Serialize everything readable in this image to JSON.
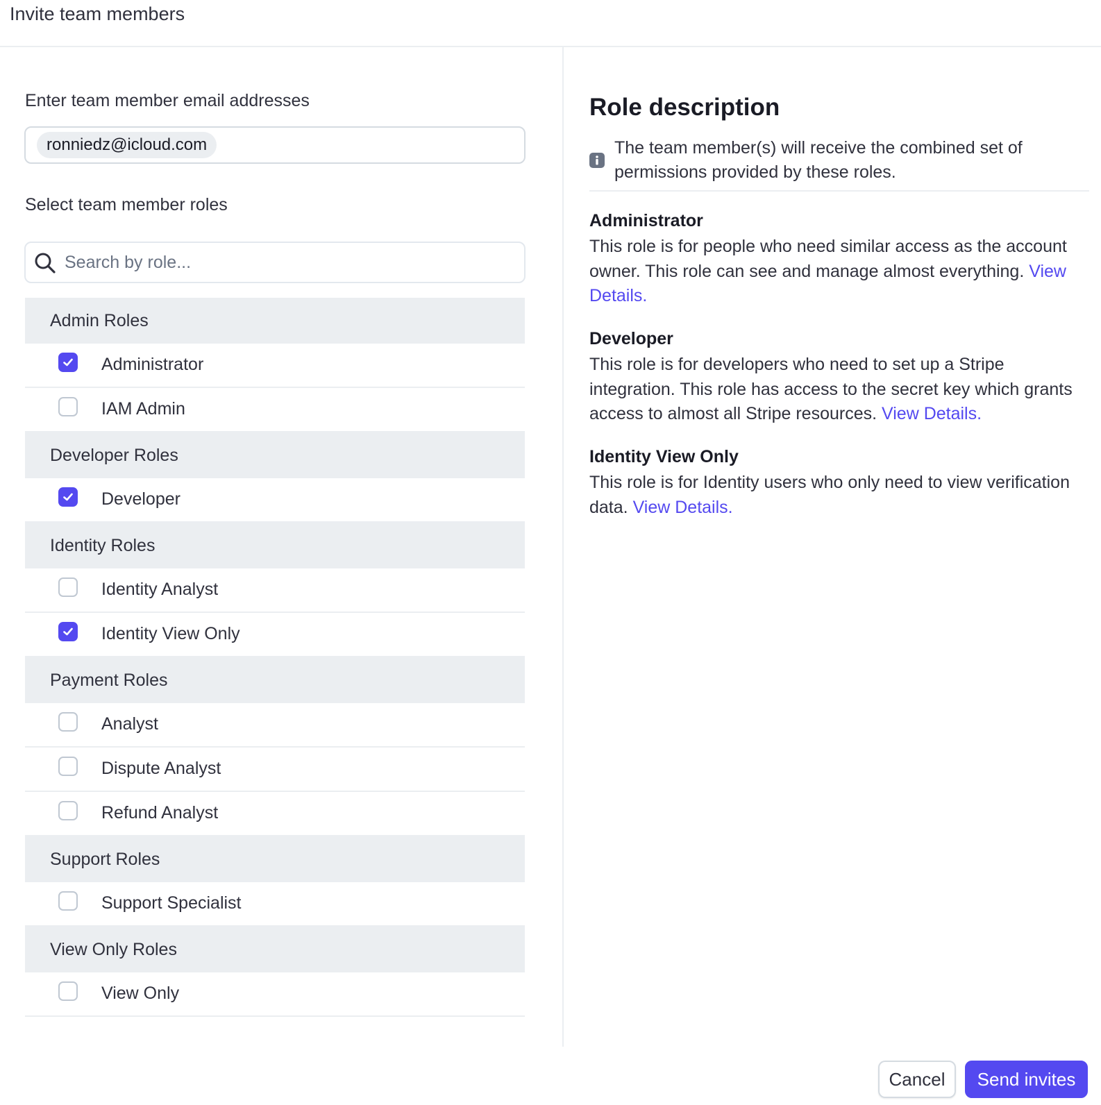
{
  "header": {
    "title": "Invite team members"
  },
  "form": {
    "email_label": "Enter team member email addresses",
    "emails": [
      "ronniedz@icloud.com"
    ],
    "roles_label": "Select team member roles",
    "search_placeholder": "Search by role...",
    "search_value": ""
  },
  "role_groups": [
    {
      "title": "Admin Roles",
      "roles": [
        {
          "label": "Administrator",
          "checked": true
        },
        {
          "label": "IAM Admin",
          "checked": false
        }
      ]
    },
    {
      "title": "Developer Roles",
      "roles": [
        {
          "label": "Developer",
          "checked": true
        }
      ]
    },
    {
      "title": "Identity Roles",
      "roles": [
        {
          "label": "Identity Analyst",
          "checked": false
        },
        {
          "label": "Identity View Only",
          "checked": true
        }
      ]
    },
    {
      "title": "Payment Roles",
      "roles": [
        {
          "label": "Analyst",
          "checked": false
        },
        {
          "label": "Dispute Analyst",
          "checked": false
        },
        {
          "label": "Refund Analyst",
          "checked": false
        }
      ]
    },
    {
      "title": "Support Roles",
      "roles": [
        {
          "label": "Support Specialist",
          "checked": false
        }
      ]
    },
    {
      "title": "View Only Roles",
      "roles": [
        {
          "label": "View Only",
          "checked": false
        }
      ]
    }
  ],
  "description": {
    "title": "Role description",
    "info_text": "The team member(s) will receive the combined set of permissions provided by these roles.",
    "roles": [
      {
        "name": "Administrator",
        "text": "This role is for people who need similar access as the account owner. This role can see and manage almost everything.",
        "link": "View Details."
      },
      {
        "name": "Developer",
        "text": "This role is for developers who need to set up a Stripe integration. This role has access to the secret key which grants access to almost all Stripe resources.",
        "link": "View Details."
      },
      {
        "name": "Identity View Only",
        "text": "This role is for Identity users who only need to view verification data.",
        "link": "View Details."
      }
    ]
  },
  "footer": {
    "cancel_label": "Cancel",
    "send_label": "Send invites"
  },
  "colors": {
    "accent": "#5449f0",
    "group_bg": "#ebeef1",
    "text": "#30313d"
  }
}
